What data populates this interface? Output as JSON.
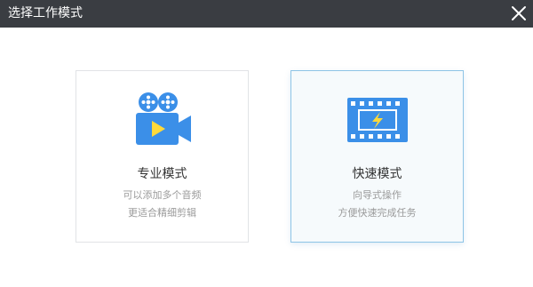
{
  "dialog": {
    "title": "选择工作模式"
  },
  "modes": [
    {
      "title": "专业模式",
      "desc_line1": "可以添加多个音频",
      "desc_line2": "更适合精细剪辑",
      "icon": "video-camera-icon",
      "selected": false
    },
    {
      "title": "快速模式",
      "desc_line1": "向导式操作",
      "desc_line2": "方便快速完成任务",
      "icon": "film-strip-lightning-icon",
      "selected": true
    }
  ],
  "colors": {
    "titlebar": "#3a3d42",
    "icon_blue": "#3b8fe8",
    "icon_yellow": "#ffd93a",
    "selected_border": "#8ec4e6"
  }
}
